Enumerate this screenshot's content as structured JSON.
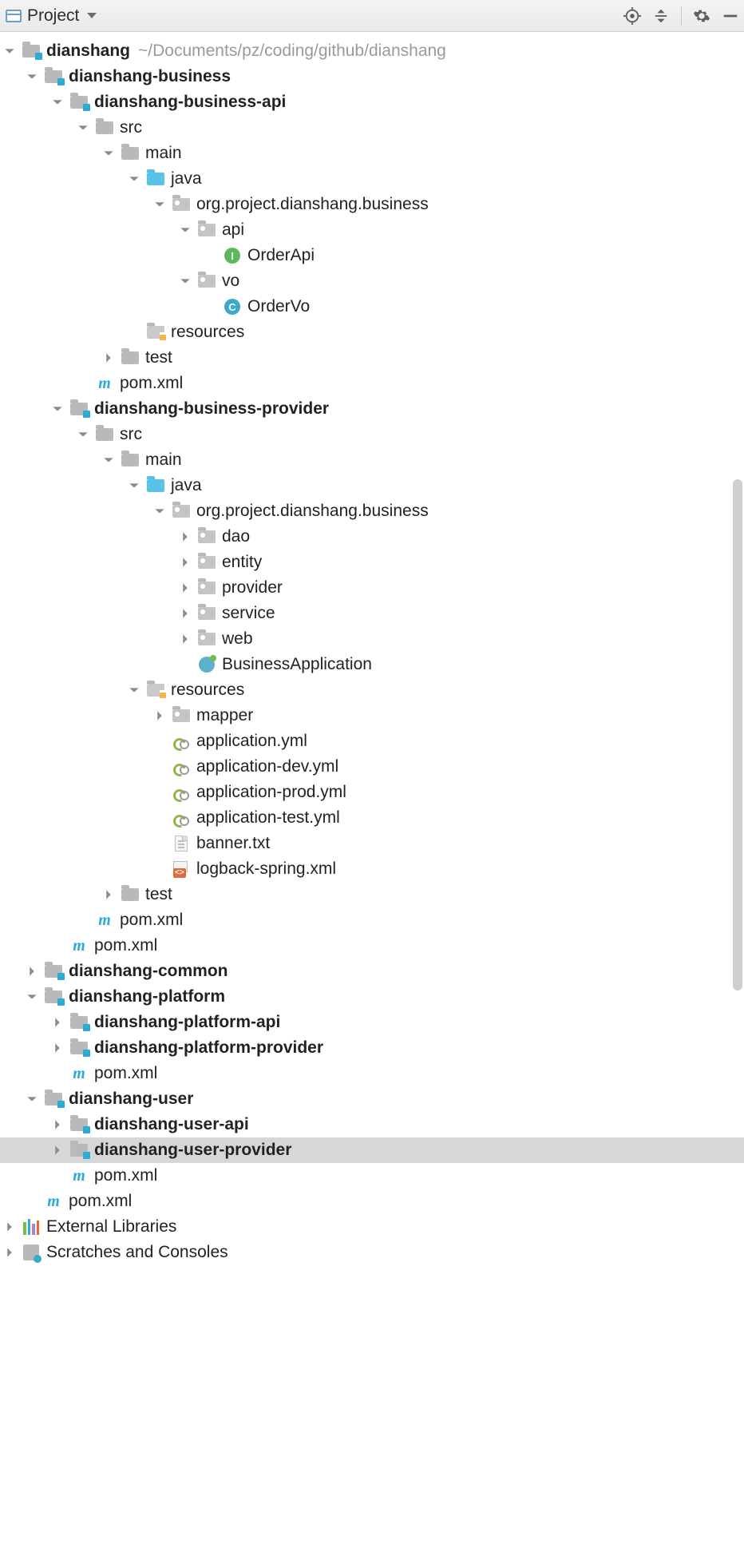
{
  "toolbar": {
    "label": "Project"
  },
  "root": {
    "name": "dianshang",
    "path": "~/Documents/pz/coding/github/dianshang"
  },
  "tree": [
    {
      "d": 0,
      "arrow": "down",
      "icon": "module",
      "label": "dianshang",
      "bold": true,
      "extra": "~/Documents/pz/coding/github/dianshang"
    },
    {
      "d": 1,
      "arrow": "down",
      "icon": "module",
      "label": "dianshang-business",
      "bold": true
    },
    {
      "d": 2,
      "arrow": "down",
      "icon": "module",
      "label": "dianshang-business-api",
      "bold": true
    },
    {
      "d": 3,
      "arrow": "down",
      "icon": "folder",
      "label": "src"
    },
    {
      "d": 4,
      "arrow": "down",
      "icon": "folder",
      "label": "main"
    },
    {
      "d": 5,
      "arrow": "down",
      "icon": "folder-blue",
      "label": "java"
    },
    {
      "d": 6,
      "arrow": "down",
      "icon": "pkg",
      "label": "org.project.dianshang.business"
    },
    {
      "d": 7,
      "arrow": "down",
      "icon": "pkg",
      "label": "api"
    },
    {
      "d": 8,
      "arrow": "blank",
      "icon": "iface",
      "label": "OrderApi"
    },
    {
      "d": 7,
      "arrow": "down",
      "icon": "pkg",
      "label": "vo"
    },
    {
      "d": 8,
      "arrow": "blank",
      "icon": "cls",
      "label": "OrderVo"
    },
    {
      "d": 5,
      "arrow": "blank",
      "icon": "res",
      "label": "resources"
    },
    {
      "d": 4,
      "arrow": "right",
      "icon": "folder",
      "label": "test"
    },
    {
      "d": 3,
      "arrow": "blank",
      "icon": "pom",
      "label": "pom.xml"
    },
    {
      "d": 2,
      "arrow": "down",
      "icon": "module",
      "label": "dianshang-business-provider",
      "bold": true
    },
    {
      "d": 3,
      "arrow": "down",
      "icon": "folder",
      "label": "src"
    },
    {
      "d": 4,
      "arrow": "down",
      "icon": "folder",
      "label": "main"
    },
    {
      "d": 5,
      "arrow": "down",
      "icon": "folder-blue",
      "label": "java"
    },
    {
      "d": 6,
      "arrow": "down",
      "icon": "pkg",
      "label": "org.project.dianshang.business"
    },
    {
      "d": 7,
      "arrow": "right",
      "icon": "pkg",
      "label": "dao"
    },
    {
      "d": 7,
      "arrow": "right",
      "icon": "pkg",
      "label": "entity"
    },
    {
      "d": 7,
      "arrow": "right",
      "icon": "pkg",
      "label": "provider"
    },
    {
      "d": 7,
      "arrow": "right",
      "icon": "pkg",
      "label": "service"
    },
    {
      "d": 7,
      "arrow": "right",
      "icon": "pkg",
      "label": "web"
    },
    {
      "d": 7,
      "arrow": "blank",
      "icon": "spring",
      "label": "BusinessApplication"
    },
    {
      "d": 5,
      "arrow": "down",
      "icon": "res",
      "label": "resources"
    },
    {
      "d": 6,
      "arrow": "right",
      "icon": "pkg",
      "label": "mapper"
    },
    {
      "d": 6,
      "arrow": "blank",
      "icon": "yml",
      "label": "application.yml"
    },
    {
      "d": 6,
      "arrow": "blank",
      "icon": "yml",
      "label": "application-dev.yml"
    },
    {
      "d": 6,
      "arrow": "blank",
      "icon": "yml",
      "label": "application-prod.yml"
    },
    {
      "d": 6,
      "arrow": "blank",
      "icon": "yml",
      "label": "application-test.yml"
    },
    {
      "d": 6,
      "arrow": "blank",
      "icon": "txt",
      "label": "banner.txt"
    },
    {
      "d": 6,
      "arrow": "blank",
      "icon": "xml",
      "label": "logback-spring.xml"
    },
    {
      "d": 4,
      "arrow": "right",
      "icon": "folder",
      "label": "test"
    },
    {
      "d": 3,
      "arrow": "blank",
      "icon": "pom",
      "label": "pom.xml"
    },
    {
      "d": 2,
      "arrow": "blank",
      "icon": "pom",
      "label": "pom.xml"
    },
    {
      "d": 1,
      "arrow": "right",
      "icon": "module",
      "label": "dianshang-common",
      "bold": true
    },
    {
      "d": 1,
      "arrow": "down",
      "icon": "module",
      "label": "dianshang-platform",
      "bold": true
    },
    {
      "d": 2,
      "arrow": "right",
      "icon": "module",
      "label": "dianshang-platform-api",
      "bold": true
    },
    {
      "d": 2,
      "arrow": "right",
      "icon": "module",
      "label": "dianshang-platform-provider",
      "bold": true
    },
    {
      "d": 2,
      "arrow": "blank",
      "icon": "pom",
      "label": "pom.xml"
    },
    {
      "d": 1,
      "arrow": "down",
      "icon": "module",
      "label": "dianshang-user",
      "bold": true
    },
    {
      "d": 2,
      "arrow": "right",
      "icon": "module",
      "label": "dianshang-user-api",
      "bold": true
    },
    {
      "d": 2,
      "arrow": "right",
      "icon": "module",
      "label": "dianshang-user-provider",
      "bold": true,
      "selected": true
    },
    {
      "d": 2,
      "arrow": "blank",
      "icon": "pom",
      "label": "pom.xml"
    },
    {
      "d": 1,
      "arrow": "blank",
      "icon": "pom",
      "label": "pom.xml"
    },
    {
      "d": 0,
      "arrow": "right",
      "icon": "lib",
      "label": "External Libraries"
    },
    {
      "d": 0,
      "arrow": "right",
      "icon": "scratch",
      "label": "Scratches and Consoles"
    }
  ]
}
